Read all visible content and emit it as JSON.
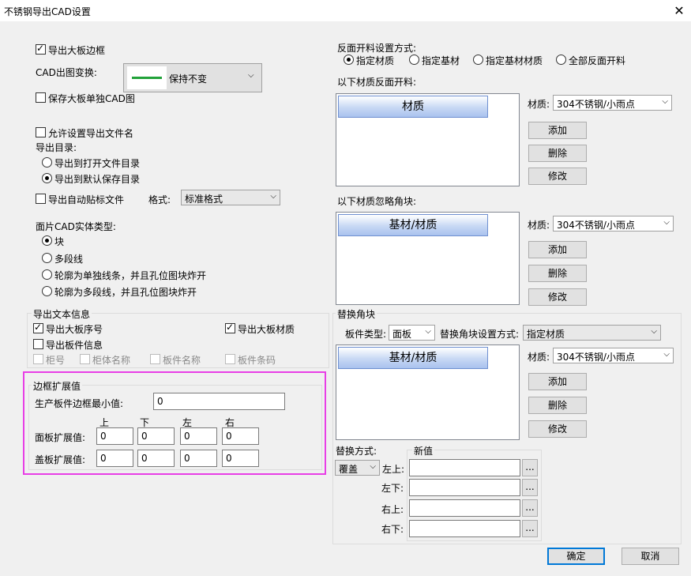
{
  "window": {
    "title": "不锈钢导出CAD设置",
    "close": "✕"
  },
  "left": {
    "export_board_frame": "导出大板边框",
    "cad_transform_label": "CAD出图变换:",
    "cad_transform_value": "保持不变",
    "save_separate_cad": "保存大板单独CAD图",
    "allow_filename": "允许设置导出文件名",
    "export_dir_label": "导出目录:",
    "dir_open": "导出到打开文件目录",
    "dir_default": "导出到默认保存目录",
    "auto_label_file": "导出自动贴标文件",
    "format_label": "格式:",
    "format_value": "标准格式",
    "solid_type_label": "面片CAD实体类型:",
    "solid_block": "块",
    "solid_polyline": "多段线",
    "solid_single_line": "轮廓为单独线条，并且孔位图块炸开",
    "solid_multi_line": "轮廓为多段线，并且孔位图块炸开"
  },
  "text_info": {
    "title": "导出文本信息",
    "board_no": "导出大板序号",
    "board_material": "导出大板材质",
    "part_info": "导出板件信息",
    "cabinet_no": "柜号",
    "cabinet_name": "柜体名称",
    "part_name": "板件名称",
    "part_barcode": "板件条码"
  },
  "frame_ext": {
    "title": "边框扩展值",
    "min_label": "生产板件边框最小值:",
    "min_value": "0",
    "col_up": "上",
    "col_down": "下",
    "col_left": "左",
    "col_right": "右",
    "face_label": "面板扩展值:",
    "face_values": [
      "0",
      "0",
      "0",
      "0"
    ],
    "cover_label": "盖板扩展值:",
    "cover_values": [
      "0",
      "0",
      "0",
      "0"
    ]
  },
  "right": {
    "reverse_mode_label": "反面开料设置方式:",
    "mode_material": "指定材质",
    "mode_base": "指定基材",
    "mode_base_material": "指定基材材质",
    "mode_all": "全部反面开料",
    "reverse_list_label": "以下材质反面开料:",
    "list1_header": "材质",
    "material_label": "材质:",
    "material_value": "304不锈钢/小雨点",
    "add": "添加",
    "delete": "删除",
    "modify": "修改",
    "ignore_list_label": "以下材质忽略角块:",
    "list2_header": "基材/材质"
  },
  "replace": {
    "title": "替换角块",
    "part_type_label": "板件类型:",
    "part_type_value": "面板",
    "mode_label": "替换角块设置方式:",
    "mode_value": "指定材质",
    "list_header": "基材/材质",
    "method_label": "替换方式:",
    "method_value": "覆盖",
    "new_value_label": "新值",
    "top_left": "左上:",
    "bottom_left": "左下:",
    "top_right": "右上:",
    "bottom_right": "右下:",
    "ellipsis": "..."
  },
  "footer": {
    "ok": "确定",
    "cancel": "取消"
  }
}
